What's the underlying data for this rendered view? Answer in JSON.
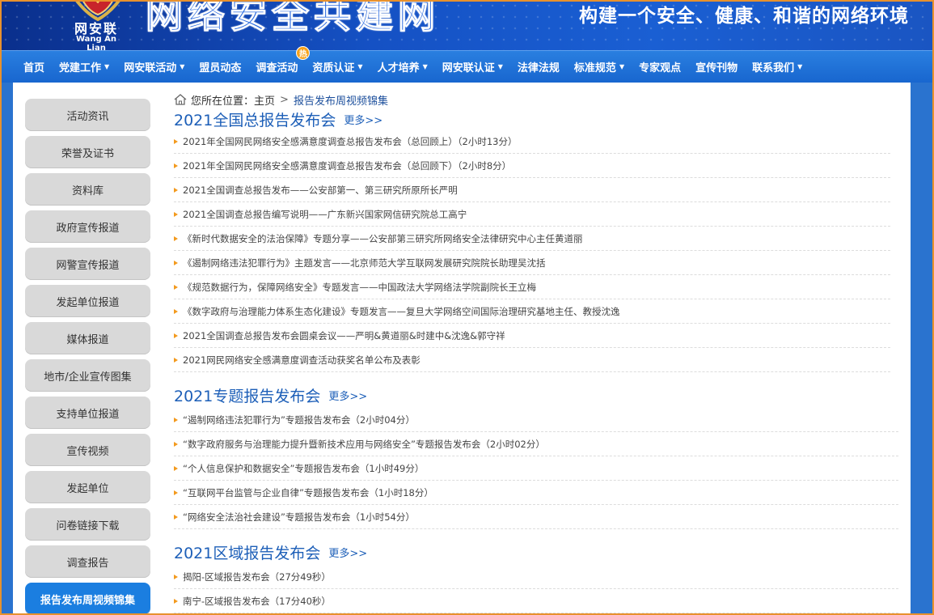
{
  "banner": {
    "logo_cn": "网安联",
    "logo_en": "Wang An Lian",
    "site_title": "网络安全共建网",
    "slogan": "构建一个安全、健康、和谐的网络环境",
    "brand_color": "#1a5fd3"
  },
  "nav": {
    "items": [
      {
        "label": "首页",
        "dropdown": false
      },
      {
        "label": "党建工作",
        "dropdown": true
      },
      {
        "label": "网安联活动",
        "dropdown": true
      },
      {
        "label": "盟员动态",
        "dropdown": false
      },
      {
        "label": "调查活动",
        "dropdown": false,
        "badge": "热"
      },
      {
        "label": "资质认证",
        "dropdown": true
      },
      {
        "label": "人才培养",
        "dropdown": true
      },
      {
        "label": "网安联认证",
        "dropdown": true
      },
      {
        "label": "法律法规",
        "dropdown": false
      },
      {
        "label": "标准规范",
        "dropdown": true
      },
      {
        "label": "专家观点",
        "dropdown": false
      },
      {
        "label": "宣传刊物",
        "dropdown": false
      },
      {
        "label": "联系我们",
        "dropdown": true
      }
    ],
    "caret": "▼"
  },
  "sidebar": {
    "items": [
      {
        "label": "活动资讯"
      },
      {
        "label": "荣誉及证书"
      },
      {
        "label": "资料库"
      },
      {
        "label": "政府宣传报道"
      },
      {
        "label": "网警宣传报道"
      },
      {
        "label": "发起单位报道"
      },
      {
        "label": "媒体报道"
      },
      {
        "label": "地市/企业宣传图集"
      },
      {
        "label": "支持单位报道"
      },
      {
        "label": "宣传视频"
      },
      {
        "label": "发起单位"
      },
      {
        "label": "问卷链接下载"
      },
      {
        "label": "调查报告"
      },
      {
        "label": "报告发布周视频锦集",
        "active": true
      }
    ],
    "active_color": "#1b7ee0"
  },
  "breadcrumb": {
    "prefix": "您所在位置：",
    "home": "主页",
    "separator": ">",
    "current": "报告发布周视频锦集"
  },
  "sections": [
    {
      "title": "2021全国总报告发布会",
      "more": "更多>>",
      "items": [
        "2021年全国网民网络安全感满意度调查总报告发布会（总回顾上）（2小时13分）",
        "2021年全国网民网络安全感满意度调查总报告发布会（总回顾下）（2小时8分）",
        "2021全国调查总报告发布——公安部第一、第三研究所原所长严明",
        "2021全国调查总报告编写说明——广东新兴国家网信研究院总工高宁",
        "《新时代数据安全的法治保障》专题分享——公安部第三研究所网络安全法律研究中心主任黄道丽",
        "《遏制网络违法犯罪行为》主题发言——北京师范大学互联网发展研究院院长助理吴沈括",
        "《规范数据行为，保障网络安全》专题发言——中国政法大学网络法学院副院长王立梅",
        "《数字政府与治理能力体系生态化建设》专题发言——复旦大学网络空间国际治理研究基地主任、教授沈逸",
        "2021全国调查总报告发布会圆桌会议——严明&黄道丽&时建中&沈逸&郭守祥",
        "2021网民网络安全感满意度调查活动获奖名单公布及表彰"
      ]
    },
    {
      "title": "2021专题报告发布会",
      "more": "更多>>",
      "items": [
        "“遏制网络违法犯罪行为”专题报告发布会（2小时04分）",
        "“数字政府服务与治理能力提升暨新技术应用与网络安全”专题报告发布会（2小时02分）",
        "“个人信息保护和数据安全”专题报告发布会（1小时49分）",
        "“互联网平台监管与企业自律”专题报告发布会（1小时18分）",
        "“网络安全法治社会建设”专题报告发布会（1小时54分）"
      ]
    },
    {
      "title": "2021区域报告发布会",
      "more": "更多>>",
      "items": [
        "揭阳-区域报告发布会（27分49秒）",
        "南宁-区域报告发布会（17分40秒）"
      ]
    }
  ],
  "colors": {
    "title_blue": "#1d5fb8",
    "bullet_orange": "#f39a1e",
    "frame_orange": "#e8912d"
  }
}
